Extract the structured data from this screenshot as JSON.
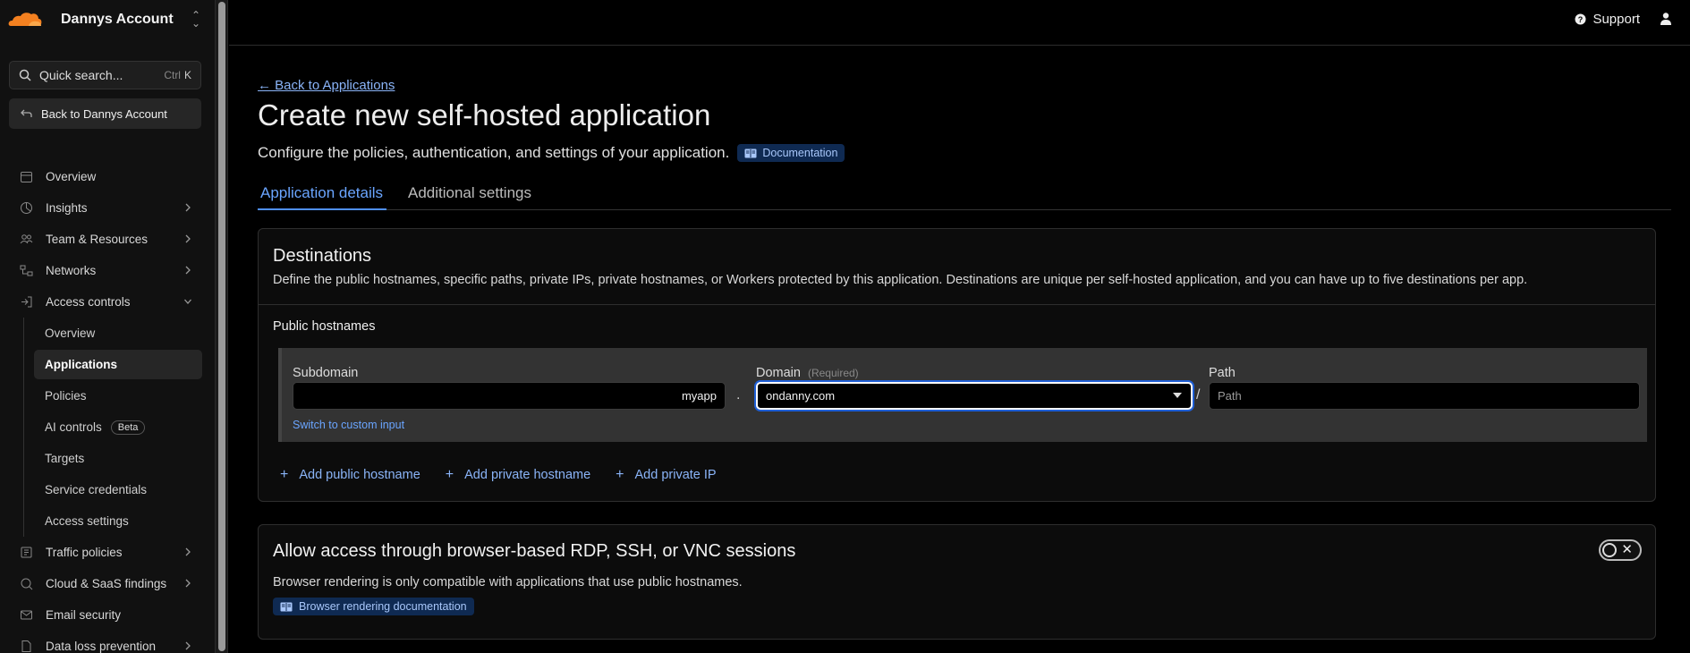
{
  "account": {
    "name": "Dannys Account"
  },
  "search": {
    "label": "Quick search...",
    "shortcut_mod": "Ctrl",
    "shortcut_key": "K"
  },
  "back_account": {
    "label": "Back to Dannys Account"
  },
  "sidebar": {
    "items": [
      {
        "label": "Overview",
        "icon": "calendar-icon"
      },
      {
        "label": "Insights",
        "icon": "insights-icon"
      },
      {
        "label": "Team & Resources",
        "icon": "team-icon"
      },
      {
        "label": "Networks",
        "icon": "network-icon"
      },
      {
        "label": "Access controls",
        "icon": "access-icon"
      }
    ],
    "access_sub": [
      {
        "label": "Overview"
      },
      {
        "label": "Applications"
      },
      {
        "label": "Policies"
      },
      {
        "label": "AI controls",
        "badge": "Beta"
      },
      {
        "label": "Targets"
      },
      {
        "label": "Service credentials"
      },
      {
        "label": "Access settings"
      }
    ],
    "more_items": [
      {
        "label": "Traffic policies"
      },
      {
        "label": "Cloud & SaaS findings"
      },
      {
        "label": "Email security"
      },
      {
        "label": "Data loss prevention"
      }
    ]
  },
  "topbar": {
    "support": "Support"
  },
  "main": {
    "back_link": "← Back to Applications",
    "title": "Create new self-hosted application",
    "subtitle": "Configure the policies, authentication, and settings of your application.",
    "doc_badge": "Documentation",
    "tabs": [
      "Application details",
      "Additional settings"
    ]
  },
  "destinations": {
    "title": "Destinations",
    "description": "Define the public hostnames, specific paths, private IPs, private hostnames, or Workers protected by this application. Destinations are unique per self-hosted application, and you can have up to five destinations per app.",
    "public_label": "Public hostnames",
    "subdomain_label": "Subdomain",
    "subdomain_value": "myapp",
    "domain_label": "Domain",
    "domain_required": "(Required)",
    "domain_value": "ondanny.com",
    "path_label": "Path",
    "path_placeholder": "Path",
    "dot": ".",
    "slash": "/",
    "switch_link": "Switch to custom input",
    "add_public": "Add public hostname",
    "add_private_host": "Add private hostname",
    "add_private_ip": "Add private IP"
  },
  "browser_rendering": {
    "title": "Allow access through browser-based RDP, SSH, or VNC sessions",
    "description": "Browser rendering is only compatible with applications that use public hostnames.",
    "doc_badge": "Browser rendering documentation",
    "toggle_on": false
  },
  "colors": {
    "accent": "#6aa5ff",
    "logo": "#f38020",
    "badge_bg": "#0f2a52"
  }
}
